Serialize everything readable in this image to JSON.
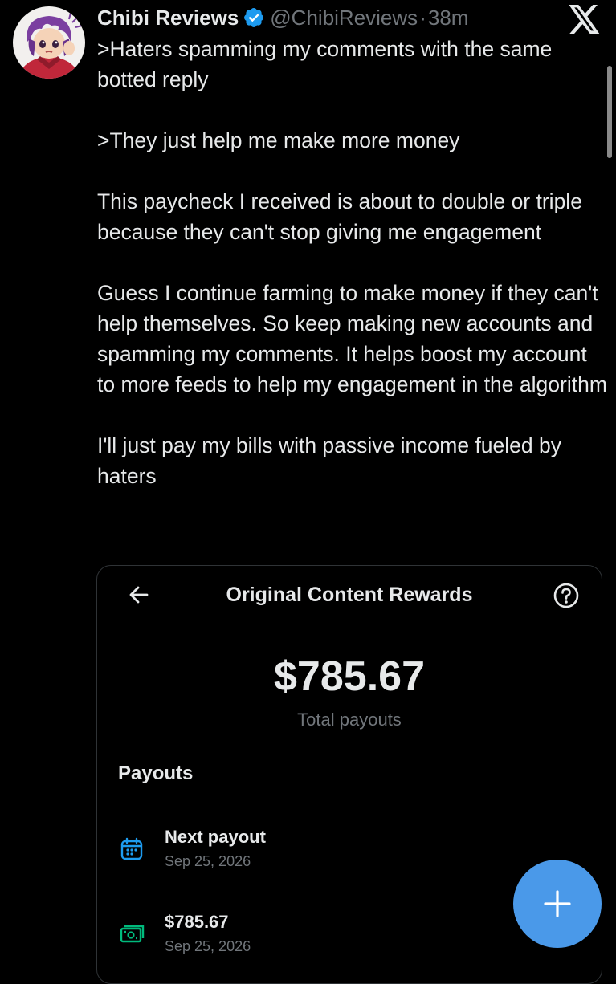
{
  "author": {
    "display_name": "Chibi Reviews",
    "handle": "@ChibiReviews",
    "separator": "·",
    "time": "38m",
    "verified": true
  },
  "app": {
    "logo": "x-logo-icon"
  },
  "tweet": {
    "paragraphs": [
      ">Haters spamming my comments with the same botted reply",
      ">They just help me make more money",
      "This paycheck I received is about to double or triple because they can't stop giving me engagement",
      "Guess I continue farming to make money if they can't help themselves. So keep making new accounts and spamming my comments. It helps boost my account to more feeds to help my engagement in the algorithm",
      "I'll just pay my bills with passive income fueled by haters"
    ]
  },
  "media": {
    "title": "Original Content Rewards",
    "back_icon": "arrow-left-icon",
    "help_icon": "question-circle-icon",
    "total_amount": "$785.67",
    "total_label": "Total payouts",
    "section_heading": "Payouts",
    "payouts": [
      {
        "title": "Next payout",
        "date": "Sep 25, 2026",
        "icon": "calendar-icon",
        "icon_color": "#1d9bf0"
      },
      {
        "title": "$785.67",
        "date": "Sep 25, 2026",
        "icon": "money-icon",
        "icon_color": "#00ba7c"
      }
    ]
  },
  "fab": {
    "icon": "plus-icon",
    "color": "#4a99e9"
  },
  "colors": {
    "background": "#000000",
    "text_primary": "#e7e9ea",
    "text_secondary": "#71767b",
    "verified_blue": "#1d9bf0"
  }
}
